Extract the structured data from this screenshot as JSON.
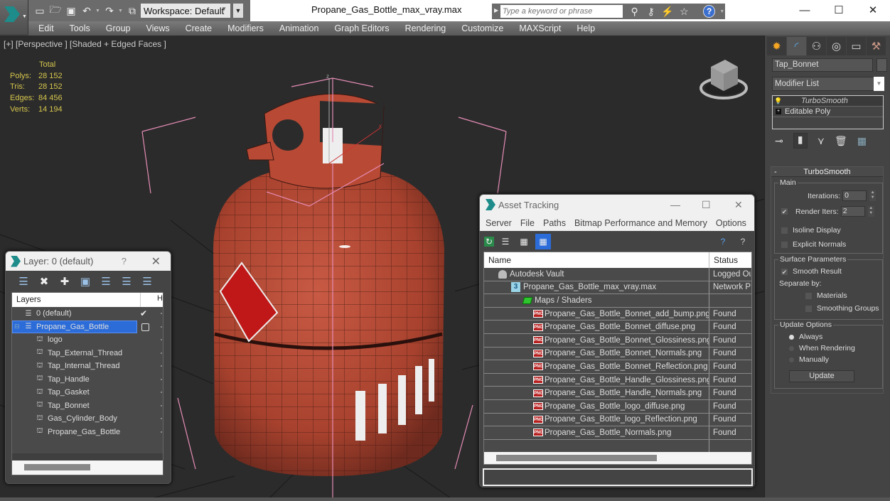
{
  "titlebar": {
    "workspace": "Workspace: Default",
    "document_title": "Propane_Gas_Bottle_max_vray.max",
    "search_placeholder": "Type a keyword or phrase",
    "quick_access_icons": [
      "new-file-icon",
      "open-folder-icon",
      "save-icon",
      "undo-icon",
      "redo-icon",
      "project-folder-icon"
    ],
    "search_tools_icons": [
      "binoculars-icon",
      "key-icon",
      "satellite-icon",
      "star-icon",
      "help-icon"
    ],
    "help_label": "?",
    "window_controls": {
      "minimize": "—",
      "maximize": "☐",
      "close": "✕"
    }
  },
  "menubar": [
    "Edit",
    "Tools",
    "Group",
    "Views",
    "Create",
    "Modifiers",
    "Animation",
    "Graph Editors",
    "Rendering",
    "Customize",
    "MAXScript",
    "Help"
  ],
  "viewport": {
    "label": "[+] [Perspective ] [Shaded + Edged Faces ]",
    "stats": {
      "header": "Total",
      "rows": [
        {
          "key": "Polys:",
          "value": "28 152"
        },
        {
          "key": "Tris:",
          "value": "28 152"
        },
        {
          "key": "Edges:",
          "value": "84 456"
        },
        {
          "key": "Verts:",
          "value": "14 194"
        }
      ]
    },
    "object_color": "#b5432f",
    "selection_bracket_color": "#e58cb5"
  },
  "layer_dialog": {
    "title": "Layer: 0 (default)",
    "help": "?",
    "close": "✕",
    "toolbar": [
      "create-layer-icon",
      "delete-icon",
      "add-icon",
      "select-objects-icon",
      "select-layer-icon",
      "hide-layers-icon",
      "layer-settings-icon"
    ],
    "column_header": "Layers",
    "column_header_2": "H",
    "rows": [
      {
        "name": "0 (default)",
        "type": "layer",
        "indent": 1,
        "active": true,
        "selected": false
      },
      {
        "name": "Propane_Gas_Bottle",
        "type": "layer",
        "indent": 1,
        "active": false,
        "selected": true
      },
      {
        "name": "logo",
        "type": "object",
        "indent": 2
      },
      {
        "name": "Tap_External_Thread",
        "type": "object",
        "indent": 2
      },
      {
        "name": "Tap_Internal_Thread",
        "type": "object",
        "indent": 2
      },
      {
        "name": "Tap_Handle",
        "type": "object",
        "indent": 2
      },
      {
        "name": "Tap_Gasket",
        "type": "object",
        "indent": 2
      },
      {
        "name": "Tap_Bonnet",
        "type": "object",
        "indent": 2
      },
      {
        "name": "Gas_Cylinder_Body",
        "type": "object",
        "indent": 2
      },
      {
        "name": "Propane_Gas_Bottle",
        "type": "object",
        "indent": 2
      }
    ]
  },
  "asset_dialog": {
    "title": "Asset Tracking",
    "menu": [
      "Server",
      "File",
      "Paths",
      "Bitmap Performance and Memory",
      "Options"
    ],
    "columns": [
      "Name",
      "Status"
    ],
    "rows": [
      {
        "name": "Autodesk Vault",
        "status": "Logged Out",
        "icon": "vault",
        "indent": 1
      },
      {
        "name": "Propane_Gas_Bottle_max_vray.max",
        "status": "Network Path",
        "icon": "max",
        "indent": 2
      },
      {
        "name": "Maps / Shaders",
        "status": "",
        "icon": "maps",
        "indent": 3
      },
      {
        "name": "Propane_Gas_Bottle_Bonnet_add_bump.png",
        "status": "Found",
        "icon": "png",
        "indent": 4
      },
      {
        "name": "Propane_Gas_Bottle_Bonnet_diffuse.png",
        "status": "Found",
        "icon": "png",
        "indent": 4
      },
      {
        "name": "Propane_Gas_Bottle_Bonnet_Glossiness.png",
        "status": "Found",
        "icon": "png",
        "indent": 4
      },
      {
        "name": "Propane_Gas_Bottle_Bonnet_Normals.png",
        "status": "Found",
        "icon": "png",
        "indent": 4
      },
      {
        "name": "Propane_Gas_Bottle_Bonnet_Reflection.png",
        "status": "Found",
        "icon": "png",
        "indent": 4
      },
      {
        "name": "Propane_Gas_Bottle_Handle_Glossiness.png",
        "status": "Found",
        "icon": "png",
        "indent": 4
      },
      {
        "name": "Propane_Gas_Bottle_Handle_Normals.png",
        "status": "Found",
        "icon": "png",
        "indent": 4
      },
      {
        "name": "Propane_Gas_Bottle_logo_diffuse.png",
        "status": "Found",
        "icon": "png",
        "indent": 4
      },
      {
        "name": "Propane_Gas_Bottle_logo_Reflection.png",
        "status": "Found",
        "icon": "png",
        "indent": 4
      },
      {
        "name": "Propane_Gas_Bottle_Normals.png",
        "status": "Found",
        "icon": "png",
        "indent": 4
      }
    ]
  },
  "command_panel": {
    "tabs": [
      "create-icon",
      "modify-icon",
      "hierarchy-icon",
      "motion-icon",
      "display-icon",
      "utilities-icon"
    ],
    "object_name": "Tap_Bonnet",
    "modifier_list": "Modifier List",
    "stack": [
      "TurboSmooth",
      "Editable Poly"
    ],
    "turbosmooth": {
      "title": "TurboSmooth",
      "main_group": "Main",
      "iterations_label": "Iterations:",
      "iterations": "0",
      "render_iters_label": "Render Iters:",
      "render_iters": "2",
      "render_iters_checked": true,
      "isoline_display": "Isoline Display",
      "isoline_checked": false,
      "explicit_normals": "Explicit Normals",
      "explicit_checked": false,
      "surface_group": "Surface Parameters",
      "smooth_result": "Smooth Result",
      "smooth_checked": true,
      "separate_by": "Separate by:",
      "materials": "Materials",
      "materials_checked": false,
      "smoothing_groups": "Smoothing Groups",
      "smoothing_checked": false,
      "update_group": "Update Options",
      "always": "Always",
      "when_rendering": "When Rendering",
      "manually": "Manually",
      "update_selected": "Always",
      "update_button": "Update"
    }
  }
}
